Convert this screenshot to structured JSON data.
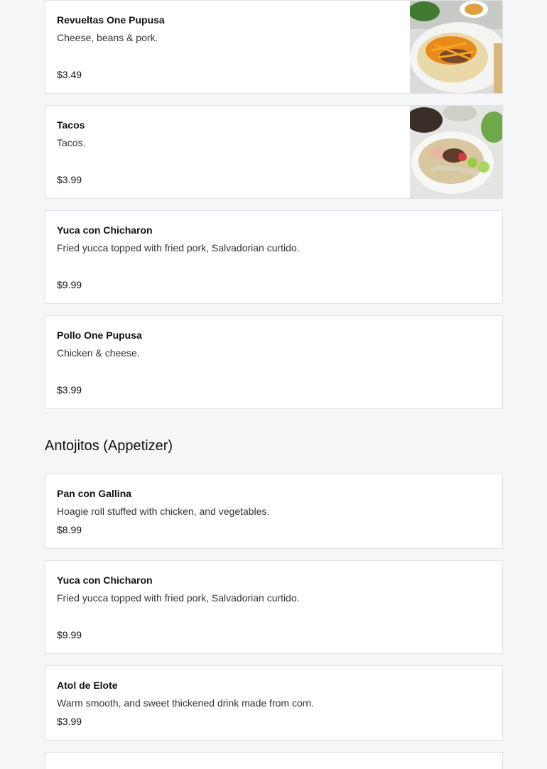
{
  "sections": [
    {
      "items": [
        {
          "name": "Revueltas One Pupusa",
          "description": "Cheese, beans & pork.",
          "price": "$3.49"
        },
        {
          "name": "Tacos",
          "description": "Tacos.",
          "price": "$3.99"
        },
        {
          "name": "Yuca con Chicharon",
          "description": "Fried yucca topped with fried pork, Salvadorian curtido.",
          "price": "$9.99"
        },
        {
          "name": "Pollo One Pupusa",
          "description": "Chicken & cheese.",
          "price": "$3.99"
        }
      ]
    },
    {
      "title": "Antojitos (Appetizer)",
      "items": [
        {
          "name": "Pan con Gallina",
          "description": "Hoagie roll stuffed with chicken, and vegetables.",
          "price": "$8.99"
        },
        {
          "name": "Yuca con Chicharon",
          "description": "Fried yucca topped with fried pork, Salvadorian curtido.",
          "price": "$9.99"
        },
        {
          "name": "Atol de Elote",
          "description": "Warm smooth, and sweet thickened drink made from corn.",
          "price": "$3.99"
        }
      ]
    }
  ]
}
